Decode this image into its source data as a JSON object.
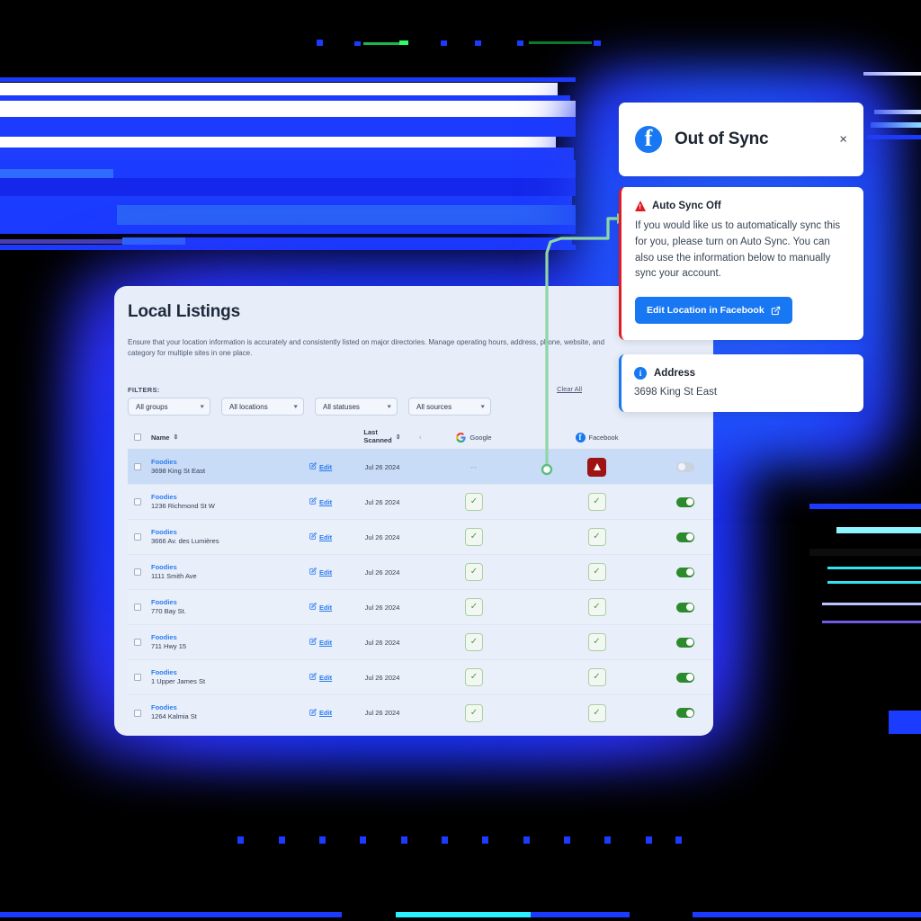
{
  "card": {
    "title": "Local Listings",
    "description": "Ensure that your location information is accurately and consistently listed on major directories. Manage operating hours, address, phone, website, and category for multiple sites in one place.",
    "filters_label": "FILTERS:",
    "clear_all": "Clear All",
    "filters": [
      {
        "label": "All groups"
      },
      {
        "label": "All locations"
      },
      {
        "label": "All statuses"
      },
      {
        "label": "All sources"
      }
    ]
  },
  "table": {
    "headers": {
      "name": "Name",
      "last_scanned": "Last\nScanned",
      "google": "Google",
      "facebook": "Facebook"
    },
    "rows": [
      {
        "name": "Foodies",
        "address": "3698 King St East",
        "edit": "Edit",
        "date": "Jul 26 2024",
        "google": "dash",
        "facebook": "warn",
        "toggle": "off",
        "selected": true
      },
      {
        "name": "Foodies",
        "address": "1236 Richmond St W",
        "edit": "Edit",
        "date": "Jul 26 2024",
        "google": "check",
        "facebook": "check",
        "toggle": "on",
        "selected": false
      },
      {
        "name": "Foodies",
        "address": "3666 Av. des Lumières",
        "edit": "Edit",
        "date": "Jul 26 2024",
        "google": "check",
        "facebook": "check",
        "toggle": "on",
        "selected": false
      },
      {
        "name": "Foodies",
        "address": "1111 Smith Ave",
        "edit": "Edit",
        "date": "Jul 26 2024",
        "google": "check",
        "facebook": "check",
        "toggle": "on",
        "selected": false
      },
      {
        "name": "Foodies",
        "address": "770 Bay St.",
        "edit": "Edit",
        "date": "Jul 26 2024",
        "google": "check",
        "facebook": "check",
        "toggle": "on",
        "selected": false
      },
      {
        "name": "Foodies",
        "address": "711 Hwy 15",
        "edit": "Edit",
        "date": "Jul 26 2024",
        "google": "check",
        "facebook": "check",
        "toggle": "on",
        "selected": false
      },
      {
        "name": "Foodies",
        "address": "1 Upper James St",
        "edit": "Edit",
        "date": "Jul 26 2024",
        "google": "check",
        "facebook": "check",
        "toggle": "on",
        "selected": false
      },
      {
        "name": "Foodies",
        "address": "1264 Kalmia St",
        "edit": "Edit",
        "date": "Jul 26 2024",
        "google": "check",
        "facebook": "check",
        "toggle": "on",
        "selected": false
      }
    ]
  },
  "popup": {
    "title": "Out of Sync",
    "close": "×",
    "alert": {
      "title": "Auto Sync Off",
      "body": "If you would like us to automatically sync this for you, please turn on Auto Sync. You can also use the information below to manually sync your account.",
      "button": "Edit Location in Facebook"
    },
    "address": {
      "title": "Address",
      "value": "3698 King St East"
    }
  },
  "colors": {
    "brand_blue": "#1877f2",
    "glow_blue": "#1b3bff",
    "alert_red": "#e01b24",
    "warn_red": "#9e1414",
    "toggle_green": "#2c8a2c",
    "connector_green": "#8fd5a6",
    "card_bg": "#e7edf9"
  }
}
